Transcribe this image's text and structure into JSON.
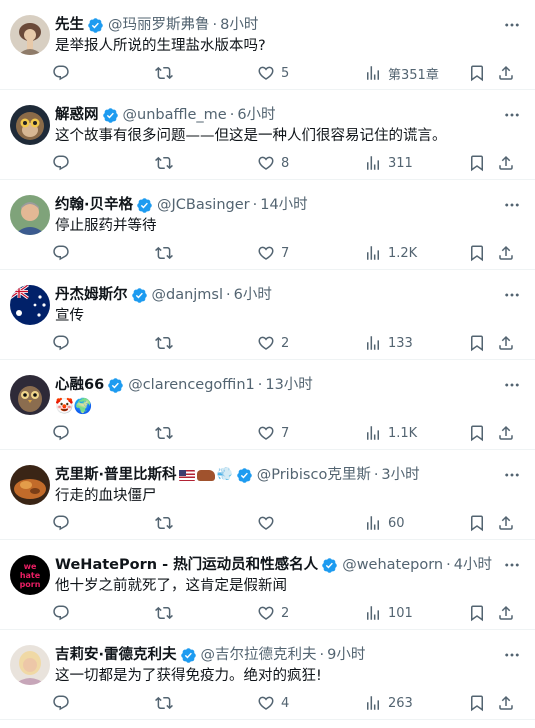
{
  "colors": {
    "verified": "#1d9bf0",
    "muted": "#536471",
    "text": "#0f1419",
    "divider": "#eff3f4"
  },
  "tweets": [
    {
      "name": "先生",
      "handle": "@玛丽罗斯弗鲁",
      "time": "8小时",
      "text": "是举报人所说的生理盐水版本吗?",
      "replies": "",
      "retweets": "",
      "likes": "5",
      "views": "第351章",
      "avatar": "lady-portrait-avatar"
    },
    {
      "name": "解惑网",
      "handle": "@unbaffle_me",
      "time": "6小时",
      "text": "这个故事有很多问题——但这是一种人们很容易记住的谎言。",
      "replies": "",
      "retweets": "",
      "likes": "8",
      "views": "311",
      "avatar": "monkey-avatar"
    },
    {
      "name": "约翰·贝辛格",
      "handle": "@JCBasinger",
      "time": "14小时",
      "text": "停止服药并等待",
      "replies": "",
      "retweets": "",
      "likes": "7",
      "views": "1.2K",
      "avatar": "man-avatar"
    },
    {
      "name": "丹杰姆斯尔",
      "handle": "@danjmsl",
      "time": "6小时",
      "text": "宣传",
      "replies": "",
      "retweets": "",
      "likes": "2",
      "views": "133",
      "avatar": "australia-flag-avatar"
    },
    {
      "name": "心融66",
      "handle": "@clarencegoffin1",
      "time": "13小时",
      "text": "🤡🌍",
      "replies": "",
      "retweets": "",
      "likes": "7",
      "views": "1.1K",
      "avatar": "owl-avatar"
    },
    {
      "name": "克里斯·普里比斯科",
      "handle": "@Pribisco克里斯",
      "time": "3小时",
      "text": "行走的血块僵尸",
      "replies": "",
      "retweets": "",
      "likes": "",
      "views": "60",
      "avatar": "food-avatar",
      "name_emojis": [
        "us-flag-emoji",
        "cow-emoji",
        "dash-emoji"
      ]
    },
    {
      "name": "WeHatePorn - 热门运动员和性感名人",
      "handle": "@wehateporn",
      "time": "4小时",
      "text": "他十岁之前就死了，这肯定是假新闻",
      "replies": "",
      "retweets": "",
      "likes": "2",
      "views": "101",
      "avatar": "wehateporn-logo-avatar",
      "avatar_logo_text": "we hate porn"
    },
    {
      "name": "吉莉安·雷德克利夫",
      "handle": "@吉尔拉德克利夫",
      "time": "9小时",
      "text": "这一切都是为了获得免疫力。绝对的疯狂!",
      "replies": "",
      "retweets": "",
      "likes": "4",
      "views": "263",
      "avatar": "woman-avatar"
    }
  ]
}
